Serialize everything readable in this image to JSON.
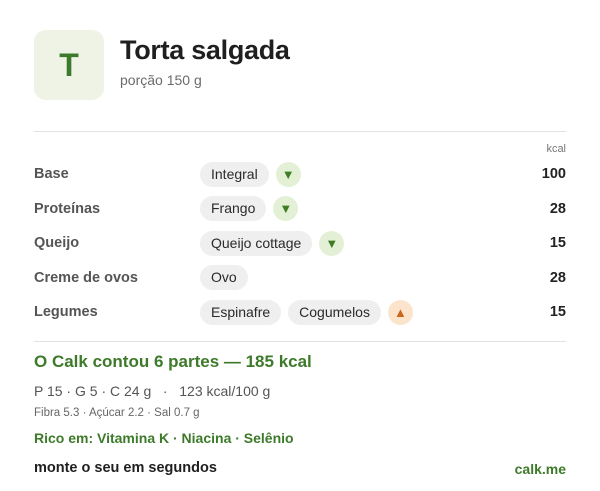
{
  "header": {
    "avatar_letter": "T",
    "title": "Torta salgada",
    "subtitle": "porção 150 g"
  },
  "table": {
    "kcal_header": "kcal",
    "rows": [
      {
        "label": "Base",
        "chips": [
          "Integral"
        ],
        "arrow": "down",
        "kcal": "100"
      },
      {
        "label": "Proteínas",
        "chips": [
          "Frango"
        ],
        "arrow": "down",
        "kcal": "28"
      },
      {
        "label": "Queijo",
        "chips": [
          "Queijo cottage"
        ],
        "arrow": "down",
        "kcal": "15"
      },
      {
        "label": "Creme de ovos",
        "chips": [
          "Ovo"
        ],
        "arrow": null,
        "kcal": "28"
      },
      {
        "label": "Legumes",
        "chips": [
          "Espinafre",
          "Cogumelos"
        ],
        "arrow": "up",
        "kcal": "15"
      }
    ]
  },
  "summary": {
    "headline": "O Calk contou 6 partes — 185 kcal",
    "macros": "P 15 · G 5 · C 24 g   ·   123 kcal/100 g",
    "micros": "Fibra 5.3 · Açúcar 2.2 · Sal 0.7 g",
    "rich_in": "Rico em: Vitamina K · Niacina · Selênio"
  },
  "footer": {
    "cta": "monte o seu em segundos",
    "link": "calk.me"
  },
  "colors": {
    "accent_green": "#3d7a2a",
    "down_arrow_bg": "#e3f0d6",
    "up_arrow_bg": "#fbe3cc",
    "up_arrow": "#c8661a"
  },
  "icons": {
    "down": "triangle-down-icon",
    "up": "triangle-up-icon"
  }
}
